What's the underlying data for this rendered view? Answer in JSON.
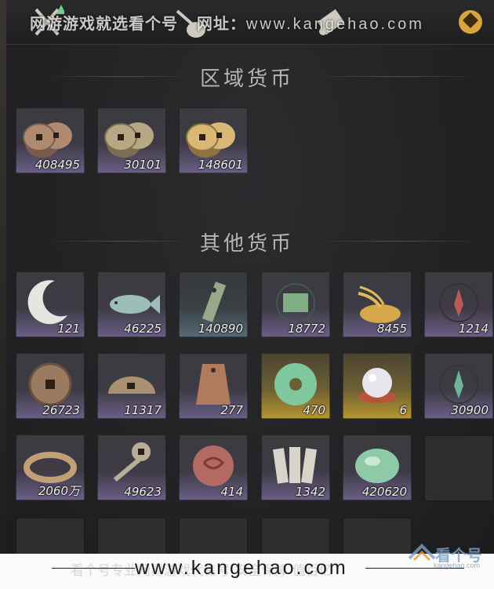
{
  "watermark": {
    "top_text": "网游游戏就选看个号",
    "top_site_label": "网址：",
    "top_site": "www.kangehao.com",
    "footer_url": "www.kangehao.com",
    "footer_ghost": "看个号专业网易游戏代售号 安全保障 值百亿",
    "logo_text": "看个号",
    "logo_sub": "kangehao.com"
  },
  "sections": {
    "regional": {
      "title": "区域货币"
    },
    "other": {
      "title": "其他货币"
    }
  },
  "regional_items": [
    {
      "icon": "copper-coins-icon",
      "count": "408495",
      "rarity": "purple"
    },
    {
      "icon": "bronze-coins-icon",
      "count": "30101",
      "rarity": "purple"
    },
    {
      "icon": "gold-coins-icon",
      "count": "148601",
      "rarity": "purple"
    }
  ],
  "other_items": [
    {
      "icon": "jade-crescent-icon",
      "count": "121",
      "rarity": "purple"
    },
    {
      "icon": "jade-fish-icon",
      "count": "46225",
      "rarity": "purple"
    },
    {
      "icon": "jade-token-icon",
      "count": "140890",
      "rarity": "blue"
    },
    {
      "icon": "green-map-icon",
      "count": "18772",
      "rarity": "purple"
    },
    {
      "icon": "grain-pile-icon",
      "count": "8455",
      "rarity": "purple"
    },
    {
      "icon": "red-emblem-icon",
      "count": "1214",
      "rarity": "purple"
    },
    {
      "icon": "ancient-coin-icon",
      "count": "26723",
      "rarity": "purple"
    },
    {
      "icon": "half-coin-icon",
      "count": "11317",
      "rarity": "purple"
    },
    {
      "icon": "bronze-tag-icon",
      "count": "277",
      "rarity": "purple"
    },
    {
      "icon": "jade-disc-icon",
      "count": "470",
      "rarity": "gold"
    },
    {
      "icon": "pearl-icon",
      "count": "6",
      "rarity": "gold"
    },
    {
      "icon": "green-emblem-icon",
      "count": "30900",
      "rarity": "purple"
    },
    {
      "icon": "coin-string-icon",
      "count": "2060万",
      "rarity": "purple"
    },
    {
      "icon": "key-coin-icon",
      "count": "49623",
      "rarity": "purple"
    },
    {
      "icon": "red-seal-icon",
      "count": "414",
      "rarity": "purple"
    },
    {
      "icon": "paper-notes-icon",
      "count": "1342",
      "rarity": "purple"
    },
    {
      "icon": "jade-stone-icon",
      "count": "420620",
      "rarity": "purple"
    }
  ]
}
